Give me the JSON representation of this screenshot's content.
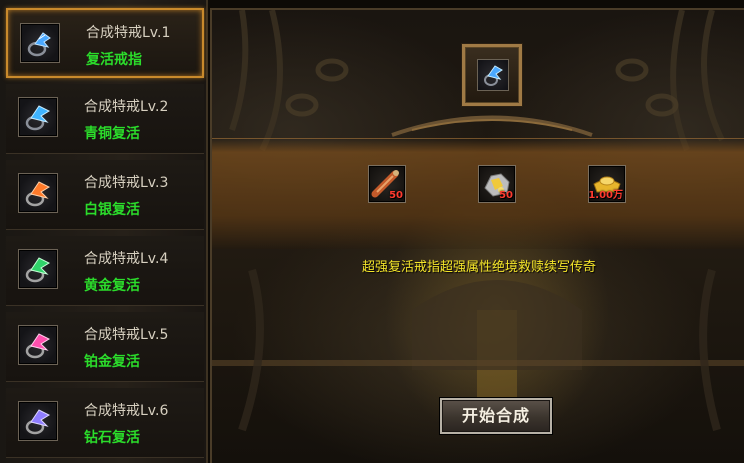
{
  "sidebar": {
    "items": [
      {
        "title": "合成特戒Lv.1",
        "subtitle": "复活戒指",
        "gem_color": "#4aa8ff",
        "active": true
      },
      {
        "title": "合成特戒Lv.2",
        "subtitle": "青铜复活",
        "gem_color": "#3fb4ff",
        "active": false
      },
      {
        "title": "合成特戒Lv.3",
        "subtitle": "白银复活",
        "gem_color": "#ff7a2a",
        "active": false
      },
      {
        "title": "合成特戒Lv.4",
        "subtitle": "黄金复活",
        "gem_color": "#30d36a",
        "active": false
      },
      {
        "title": "合成特戒Lv.5",
        "subtitle": "铂金复活",
        "gem_color": "#ff4fae",
        "active": false
      },
      {
        "title": "合成特戒Lv.6",
        "subtitle": "钻石复活",
        "gem_color": "#8f7dff",
        "active": false
      }
    ]
  },
  "main": {
    "result_item": {
      "icon": "blue-revive-ring-icon",
      "gem_color": "#4aa8ff"
    },
    "materials": [
      {
        "icon": "scroll-icon",
        "count": "50"
      },
      {
        "icon": "gold-ore-icon",
        "count": "50"
      },
      {
        "icon": "gold-ingot-icon",
        "count": "1.00万"
      }
    ],
    "description": "超强复活戒指超强属性绝境救赎续写传奇",
    "start_button_label": "开始合成"
  },
  "colors": {
    "accent_border": "#c98a2c",
    "subtitle_green": "#2bdc2b",
    "description_yellow": "#f4e52a",
    "count_red": "#ff3b2f"
  }
}
